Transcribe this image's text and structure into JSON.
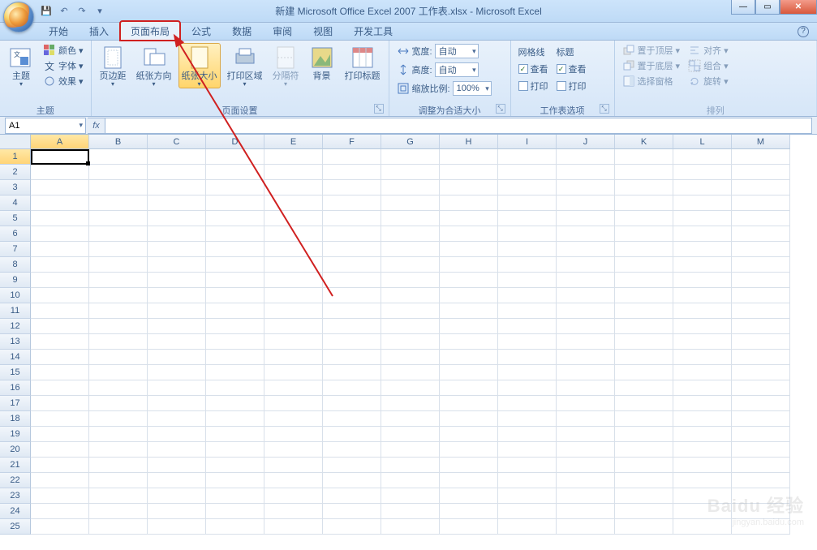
{
  "title": "新建 Microsoft Office Excel 2007 工作表.xlsx - Microsoft Excel",
  "qat": {
    "save": "💾",
    "undo": "↶",
    "redo": "↷",
    "more": "▾"
  },
  "tabs": [
    "开始",
    "插入",
    "页面布局",
    "公式",
    "数据",
    "审阅",
    "视图",
    "开发工具"
  ],
  "active_tab_index": 2,
  "ribbon": {
    "theme": {
      "label": "主题",
      "main": "主题",
      "colors": "颜色",
      "fonts": "字体",
      "effects": "效果"
    },
    "pagesetup": {
      "label": "页面设置",
      "margins": "页边距",
      "orientation": "纸张方向",
      "size": "纸张大小",
      "printarea": "打印区域",
      "breaks": "分隔符",
      "background": "背景",
      "titles": "打印标题"
    },
    "scale": {
      "label": "调整为合适大小",
      "width_label": "宽度:",
      "width_value": "自动",
      "height_label": "高度:",
      "height_value": "自动",
      "scale_label": "缩放比例:",
      "scale_value": "100%"
    },
    "sheetopts": {
      "label": "工作表选项",
      "gridlines": "网格线",
      "headings": "标题",
      "view": "查看",
      "print": "打印"
    },
    "arrange": {
      "label": "排列",
      "bringfront": "置于顶层",
      "sendback": "置于底层",
      "selection": "选择窗格",
      "align": "对齐",
      "group": "组合",
      "rotate": "旋转"
    }
  },
  "name_box": "A1",
  "fx_label": "fx",
  "columns": [
    "A",
    "B",
    "C",
    "D",
    "E",
    "F",
    "G",
    "H",
    "I",
    "J",
    "K",
    "L",
    "M"
  ],
  "row_count": 25,
  "active_cell": {
    "col": 0,
    "row": 0
  },
  "watermark": {
    "big": "Baidu 经验",
    "small": "jingyan.baidu.com"
  }
}
